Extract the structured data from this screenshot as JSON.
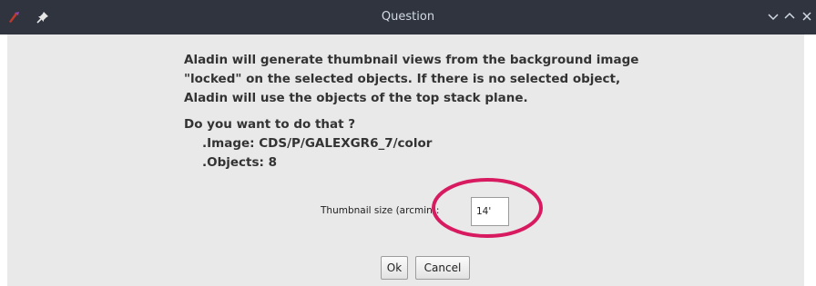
{
  "window": {
    "title": "Question"
  },
  "icons": {
    "app": "aladin-app-icon",
    "pin": "pin-icon",
    "minimize": "chevron-down-icon",
    "maximize": "chevron-up-icon",
    "close": "close-icon"
  },
  "message": {
    "line1": "Aladin will generate thumbnail views from the background image",
    "line2": "\"locked\" on the selected objects. If there is no selected object,",
    "line3": "Aladin will use the objects of the top stack plane.",
    "question": "Do you want to do that ?",
    "image_line": ".Image: CDS/P/GALEXGR6_7/color",
    "objects_line": ".Objects: 8"
  },
  "thumbnail": {
    "label": "Thumbnail size (arcmin):",
    "value": "14'"
  },
  "buttons": {
    "ok": "Ok",
    "cancel": "Cancel"
  },
  "colors": {
    "titlebar": "#2f343f",
    "dialog_bg": "#e9e9e9",
    "annotation": "#d81b60"
  }
}
